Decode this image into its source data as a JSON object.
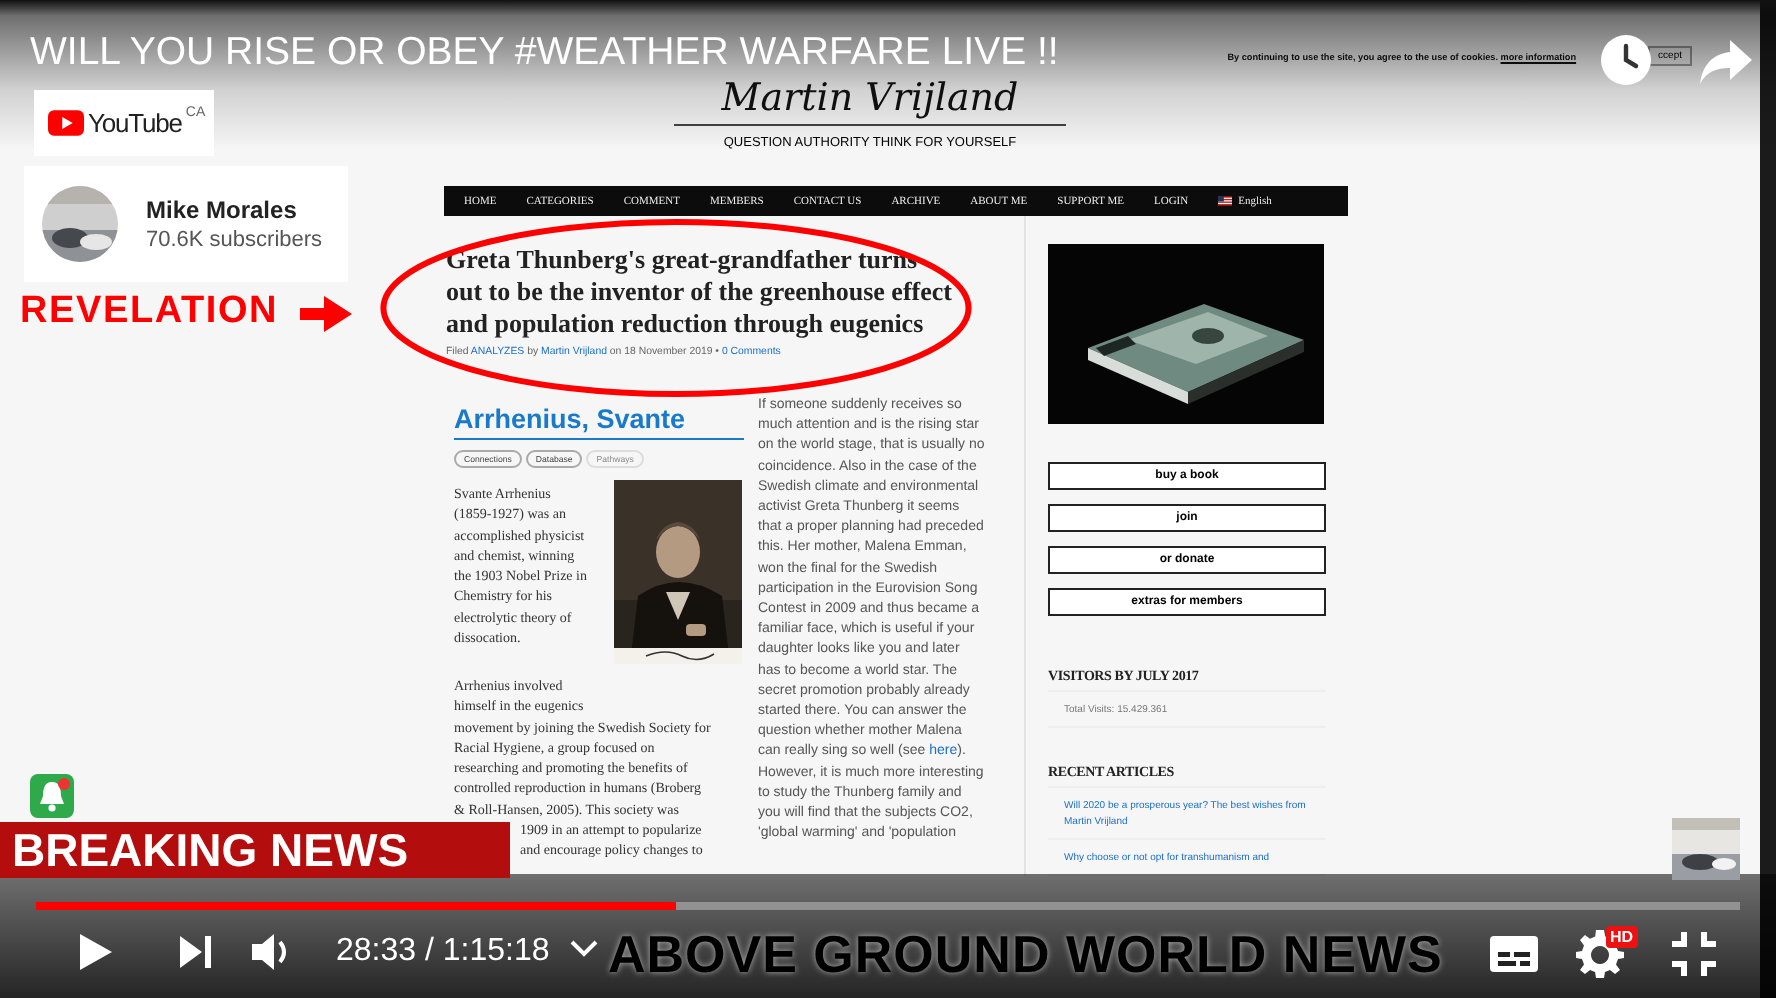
{
  "video": {
    "title": "WILL YOU RISE OR OBEY #WEATHER WARFARE LIVE !!",
    "overlay_label": "REVELATION",
    "banner": "BREAKING NEWS",
    "caption": "ABOVE GROUND WORLD NEWS"
  },
  "youtube_logo": {
    "wordmark": "YouTube",
    "region": "CA"
  },
  "channel": {
    "name": "Mike Morales",
    "subscribers": "70.6K subscribers"
  },
  "site": {
    "logo": "Martin Vrijland",
    "tagline": "QUESTION AUTHORITY THINK FOR YOURSELF",
    "cookie_notice": {
      "text": "By continuing to use the site, you agree to the use of cookies.",
      "link": "more information",
      "button": "ccept"
    },
    "nav": [
      {
        "label": "HOME",
        "kind": "link"
      },
      {
        "label": "CATEGORIES",
        "kind": "link"
      },
      {
        "label": "COMMENT",
        "kind": "link"
      },
      {
        "label": "MEMBERS",
        "kind": "link"
      },
      {
        "label": "CONTACT US",
        "kind": "link"
      },
      {
        "label": "ARCHIVE",
        "kind": "link"
      },
      {
        "label": "ABOUT ME",
        "kind": "link"
      },
      {
        "label": "SUPPORT ME",
        "kind": "link"
      },
      {
        "label": "LOGIN",
        "kind": "link"
      },
      {
        "label": "English",
        "kind": "language"
      }
    ],
    "article": {
      "headline": "Greta Thunberg's great-grandfather turns out to be the inventor of the greenhouse effect and population reduction through eugenics",
      "meta": {
        "filed": "Filed",
        "category": "ANALYZES",
        "by": "by",
        "author": "Martin Vrijland",
        "date": "on 18 November 2019 •",
        "comments": "0 Comments"
      },
      "bio": {
        "heading": "Arrhenius, Svante",
        "tags": [
          {
            "label": "Connections",
            "disabled": false
          },
          {
            "label": "Database",
            "disabled": false
          },
          {
            "label": "Pathways",
            "disabled": true
          }
        ],
        "paragraph_1": [
          "Svante Arrhenius",
          "(1859-1927) was an",
          "accomplished physicist",
          "and chemist, winning",
          "the 1903 Nobel Prize in",
          "Chemistry for his",
          "electrolytic theory of",
          "dissocation."
        ],
        "paragraph_2": [
          "Arrhenius involved",
          "himself in the eugenics",
          "movement by joining the Swedish Society for",
          "Racial Hygiene, a group focused on",
          "researching and promoting the benefits of",
          "controlled reproduction in humans (Broberg",
          "& Roll-Hansen, 2005). This society was"
        ],
        "partial_lines": [
          "1909 in an attempt to popularize",
          "and encourage policy changes to"
        ]
      },
      "text_lines": [
        "If someone suddenly receives so",
        "much attention and is the rising star",
        "on the world stage, that is usually no",
        "coincidence. Also in the case of the",
        "Swedish climate and environmental",
        "activist Greta Thunberg it seems",
        "that a proper planning had preceded",
        "this. Her mother, Malena Emman,",
        "won the final for the Swedish",
        "participation in the Eurovision Song",
        "Contest in 2009 and thus became a",
        "familiar face, which is useful if your",
        "daughter looks like you and later",
        "has to become a world star. The",
        "secret promotion probably already",
        "started there. You can answer the",
        "question whether mother Malena",
        {
          "before": "can really sing so well (see ",
          "link": "here",
          "after": ")."
        },
        "However, it is much more interesting",
        "to study the Thunberg family and",
        "you will find that the subjects CO2,",
        "'global warming' and 'population"
      ]
    },
    "sidebar": {
      "buttons": [
        "buy a book",
        "join",
        "or donate",
        "extras for members"
      ],
      "visitors_heading": "VISITORS BY JULY 2017",
      "visits": "Total Visits: 15.429.361",
      "recent_heading": "RECENT ARTICLES",
      "recent": [
        "Will 2020 be a prosperous year? The best wishes from Martin Vrijland",
        "Why choose or not opt for transhumanism and"
      ]
    }
  },
  "player": {
    "time": "28:33 / 1:15:18",
    "quality_badge": "HD",
    "progress": {
      "level": 0.376
    }
  }
}
